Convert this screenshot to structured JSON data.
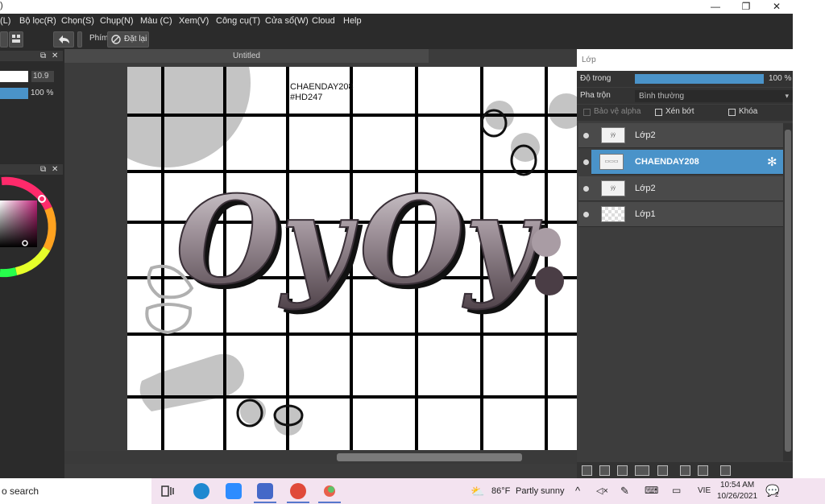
{
  "window": {
    "title_fragment": ")",
    "controls": {
      "minimize": "—",
      "restore": "❐",
      "close": "✕"
    }
  },
  "menu": [
    "(L)",
    "Bộ lọc(R)",
    "Chọn(S)",
    "Chụp(N)",
    "Màu (C)",
    "Xem(V)",
    "Công cụ(T)",
    "Cửa sổ(W)",
    "Cloud",
    "Help"
  ],
  "toolbar": {
    "key_label": "Phím",
    "reset_label": "Đặt lại"
  },
  "left_panel": {
    "brush_size": "10.9",
    "opacity": "100 %"
  },
  "document": {
    "tab_title": "Untitled",
    "watermark_line1": "CHAENDAY208",
    "watermark_line2": "#HD247"
  },
  "layers_panel": {
    "title": "Lớp",
    "opacity_label": "Độ trong",
    "opacity_value": "100 %",
    "opacity_fraction": 1.0,
    "blend_label": "Pha trộn",
    "blend_value": "Bình thường",
    "protect_alpha_label": "Bảo vệ alpha",
    "clipping_label": "Xén bớt",
    "lock_label": "Khóa",
    "layers": [
      {
        "name": "Lớp2",
        "selected": false,
        "thumb": "ẏẏ"
      },
      {
        "name": "CHAENDAY208",
        "selected": true,
        "thumb": "▭▭▭"
      },
      {
        "name": "Lớp2",
        "selected": false,
        "thumb": "ẏẏ"
      },
      {
        "name": "Lớp1",
        "selected": false,
        "thumb": ""
      }
    ]
  },
  "taskbar": {
    "search_placeholder": "o search",
    "weather_temp": "86°F",
    "weather_desc": "Partly sunny",
    "lang": "VIE",
    "time": "10:54 AM",
    "date": "10/26/2021",
    "notification_count": "2"
  },
  "colors": {
    "accent_blue": "#4a93c9",
    "panel_dark": "#2b2b2b",
    "taskbar_bg": "#f3e3f0"
  }
}
